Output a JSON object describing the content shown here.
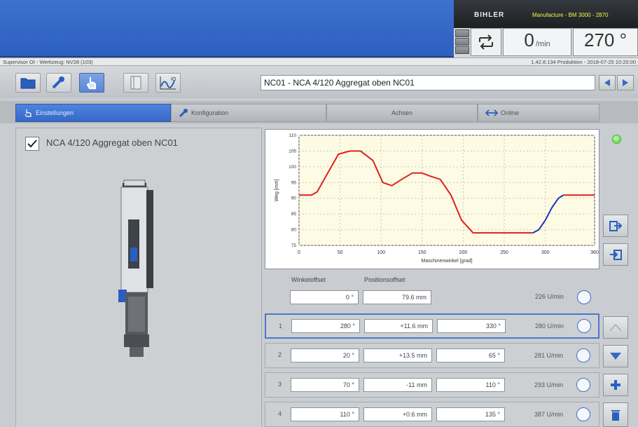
{
  "header": {
    "brand": "BIHLER",
    "manufacture": "Manufacture - BM 3000 - 2870",
    "speed_value": "0",
    "speed_unit": "/min",
    "angle_value": "270 °"
  },
  "status_bar": {
    "left": "Supervisor OI - Werkzeug: NV28 (103)",
    "right": "1.42.8.134 Produktion - 2018-07-25 10:20:00"
  },
  "toolbar": {
    "title_value": "NC01 - NCA 4/120 Aggregat oben NC01"
  },
  "tabs": [
    {
      "label": "Einstellungen"
    },
    {
      "label": "Konfiguration"
    },
    {
      "label": "Achsen"
    },
    {
      "label": "Online"
    }
  ],
  "tool": {
    "name": "NCA 4/120 Aggregat oben NC01",
    "checked": true
  },
  "table": {
    "header_angle_offset": "Winkeloffset",
    "header_position_offset": "Positionsoffset",
    "offset_row": {
      "angle": "0 °",
      "position": "79.6 mm",
      "speed": "226 U/min"
    },
    "rows": [
      {
        "num": "1",
        "angle": "280 °",
        "position": "+11.6 mm",
        "end": "330 °",
        "speed": "280 U/min"
      },
      {
        "num": "2",
        "angle": "20 °",
        "position": "+13.5 mm",
        "end": "65 °",
        "speed": "281 U/min"
      },
      {
        "num": "3",
        "angle": "70 °",
        "position": "-11 mm",
        "end": "110 °",
        "speed": "293 U/min"
      },
      {
        "num": "4",
        "angle": "110 °",
        "position": "+0.6 mm",
        "end": "135 °",
        "speed": "387 U/min"
      }
    ]
  },
  "chart_data": {
    "type": "line",
    "xlabel": "Maschinenwinkel [grad]",
    "ylabel": "Weg [mm]",
    "xlim": [
      0,
      360
    ],
    "ylim": [
      75,
      110
    ],
    "xticks": [
      0,
      50,
      100,
      150,
      200,
      250,
      300,
      360
    ],
    "yticks": [
      75,
      80,
      85,
      90,
      95,
      100,
      105,
      110
    ],
    "grid": true,
    "series": [
      {
        "color": "#e02020",
        "x": [
          0,
          15,
          22,
          35,
          48,
          62,
          75,
          90,
          102,
          113,
          125,
          138,
          150,
          160,
          172,
          185,
          198,
          212,
          230,
          250,
          270,
          285
        ],
        "y": [
          91,
          91,
          92,
          98,
          104,
          105,
          105,
          102,
          95,
          94,
          96,
          98,
          98,
          97,
          96,
          91,
          83,
          79,
          79,
          79,
          79,
          79
        ]
      },
      {
        "color": "#1a30c0",
        "x": [
          285,
          292,
          300,
          308,
          316,
          322
        ],
        "y": [
          79,
          80,
          83,
          87,
          90,
          91
        ]
      },
      {
        "color": "#e02020",
        "x": [
          322,
          360
        ],
        "y": [
          91,
          91
        ]
      }
    ]
  },
  "colors": {
    "accent": "#3569c6",
    "banner": "#3c72cf",
    "status_led": "#49cf3a"
  }
}
